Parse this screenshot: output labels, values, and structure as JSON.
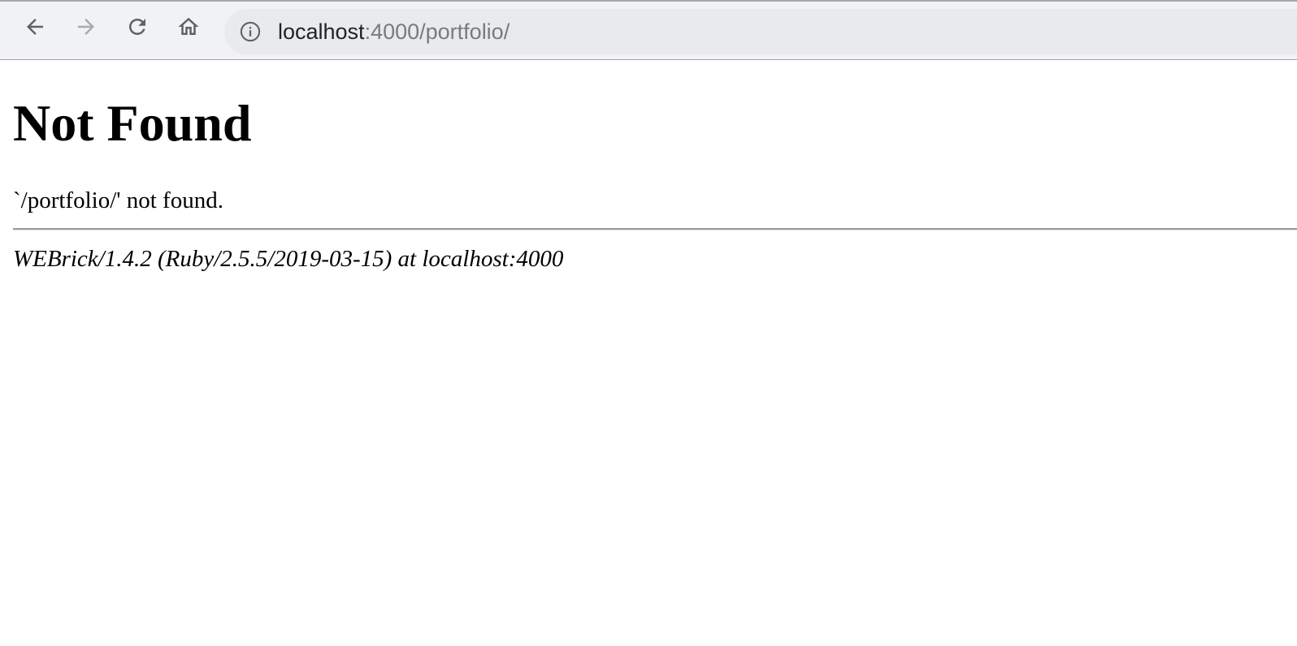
{
  "browser": {
    "nav_icons": {
      "back": "arrow-left-icon",
      "forward": "arrow-right-icon",
      "reload": "reload-icon",
      "home": "home-icon",
      "site_info": "info-icon"
    },
    "url_host": "localhost",
    "url_rest": ":4000/portfolio/",
    "colors": {
      "toolbar_bg": "#f1f2f3",
      "omnibox_bg": "#e9eaec",
      "icon_active": "#5f6368",
      "icon_disabled": "#a9abad"
    }
  },
  "page": {
    "heading": "Not Found",
    "message": "`/portfolio/' not found.",
    "server_signature": "WEBrick/1.4.2 (Ruby/2.5.5/2019-03-15) at localhost:4000"
  }
}
